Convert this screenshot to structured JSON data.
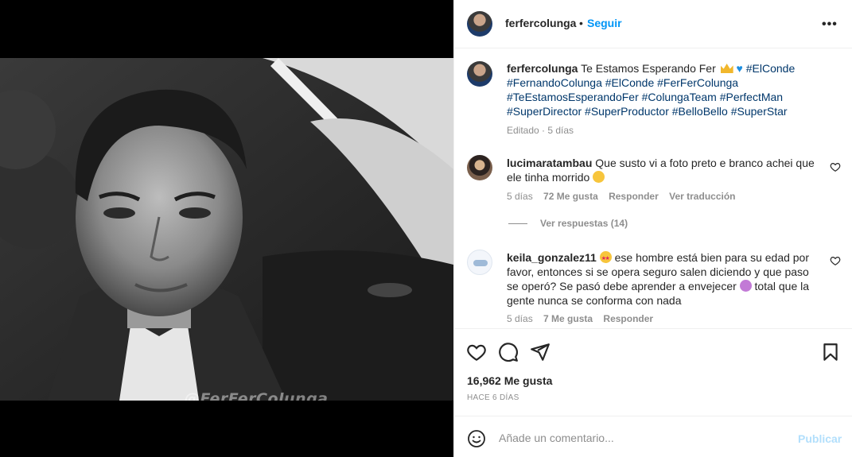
{
  "post": {
    "username": "ferfercolunga",
    "follow_label": "Seguir",
    "separator": "•",
    "more_label": "•••",
    "watermark": "@FerFerColunga"
  },
  "caption": {
    "username": "ferfercolunga",
    "text": "Te Estamos Esperando Fer",
    "hashtags_line1": "#ElConde",
    "hashtags_line2": "#FernandoColunga #ElConde #FerFerColunga",
    "hashtags_line3": "#TeEstamosEsperandoFer #ColungaTeam #PerfectMan",
    "hashtags_line4": "#SuperDirector #SuperProductor #BelloBello #SuperStar",
    "meta": "Editado · 5 días"
  },
  "comments": [
    {
      "username": "lucimaratambau",
      "text": "Que susto vi a foto preto e branco achei que ele tinha morrido",
      "time": "5 días",
      "likes": "72 Me gusta",
      "reply_label": "Responder",
      "translate_label": "Ver traducción",
      "view_replies": "Ver respuestas (14)"
    },
    {
      "username": "keila_gonzalez11",
      "text": "ese hombre está bien para su edad por favor, entonces si se opera seguro salen diciendo y que paso se operó? Se pasó debe aprender a envejecer",
      "text_end": "total que la gente nunca se conforma con nada",
      "time": "5 días",
      "likes": "7 Me gusta",
      "reply_label": "Responder"
    }
  ],
  "footer": {
    "likes": "16,962 Me gusta",
    "ago": "HACE 6 DÍAS",
    "comment_placeholder": "Añade un comentario...",
    "publish_label": "Publicar"
  },
  "icons": {
    "like": "heart-icon",
    "comment": "comment-icon",
    "share": "send-icon",
    "save": "bookmark-icon",
    "emoji": "smile-icon"
  },
  "colors": {
    "accent": "#0095f6",
    "hashtag": "#00376b",
    "muted": "#8e8e8e",
    "publish_disabled": "#b2dffc"
  }
}
